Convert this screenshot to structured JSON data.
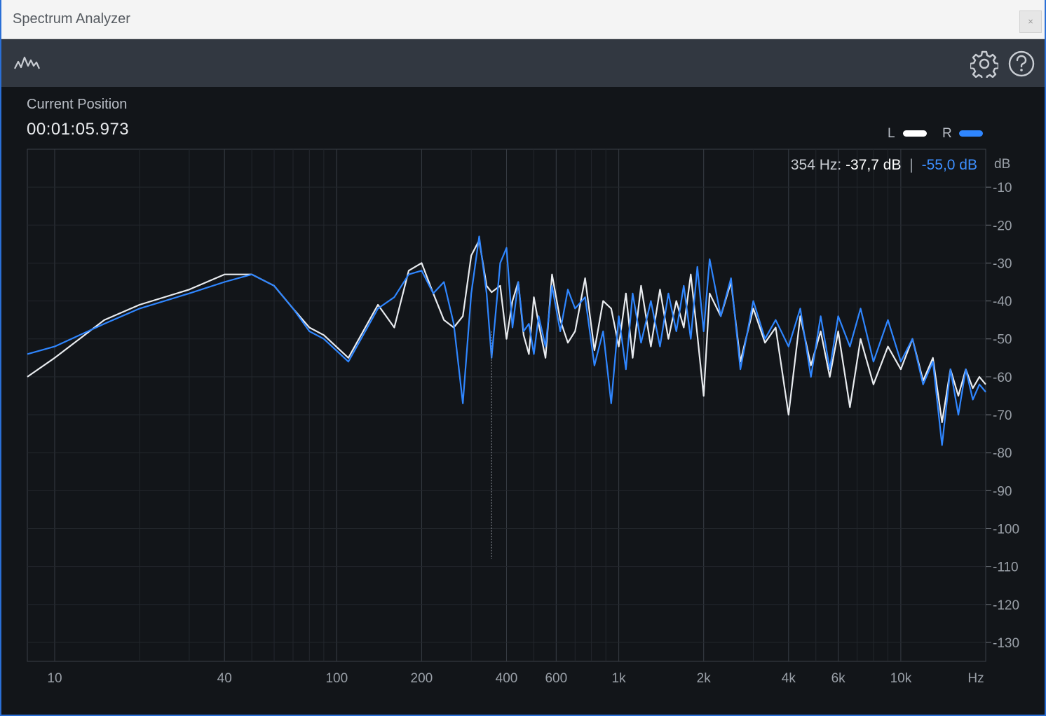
{
  "window": {
    "title": "Spectrum Analyzer",
    "close_label": "×"
  },
  "toolbar": {
    "left_icon": "spectrum-wave-icon",
    "settings_icon": "gear-icon",
    "help_icon": "help-circle-icon"
  },
  "position": {
    "label": "Current Position",
    "value": "00:01:05.973"
  },
  "legend": {
    "left": "L",
    "right": "R",
    "left_color": "#ffffff",
    "right_color": "#2f86ff"
  },
  "readout": {
    "freq": "354 Hz:",
    "left_db": "-37,7 dB",
    "separator": "|",
    "right_db": "-55,0 dB",
    "cursor_hz": 354
  },
  "chart_data": {
    "type": "line",
    "xscale": "log",
    "xlim": [
      8,
      20000
    ],
    "ylim": [
      0,
      -135
    ],
    "xlabel": "Hz",
    "ylabel": "dB",
    "x_ticks": [
      {
        "v": 10,
        "label": "10"
      },
      {
        "v": 40,
        "label": "40"
      },
      {
        "v": 100,
        "label": "100"
      },
      {
        "v": 200,
        "label": "200"
      },
      {
        "v": 400,
        "label": "400"
      },
      {
        "v": 600,
        "label": "600"
      },
      {
        "v": 1000,
        "label": "1k"
      },
      {
        "v": 2000,
        "label": "2k"
      },
      {
        "v": 4000,
        "label": "4k"
      },
      {
        "v": 6000,
        "label": "6k"
      },
      {
        "v": 10000,
        "label": "10k"
      }
    ],
    "y_ticks": [
      -10,
      -20,
      -30,
      -40,
      -50,
      -60,
      -70,
      -80,
      -90,
      -100,
      -110,
      -120,
      -130
    ],
    "series": [
      {
        "name": "L",
        "color": "#e8ebef",
        "points": [
          [
            8,
            -60
          ],
          [
            10,
            -55
          ],
          [
            15,
            -45
          ],
          [
            20,
            -41
          ],
          [
            30,
            -37
          ],
          [
            40,
            -33
          ],
          [
            50,
            -33
          ],
          [
            60,
            -36
          ],
          [
            70,
            -42
          ],
          [
            80,
            -47
          ],
          [
            90,
            -49
          ],
          [
            110,
            -55
          ],
          [
            140,
            -41
          ],
          [
            160,
            -47
          ],
          [
            180,
            -32
          ],
          [
            200,
            -30
          ],
          [
            220,
            -38
          ],
          [
            240,
            -45
          ],
          [
            260,
            -47
          ],
          [
            280,
            -44
          ],
          [
            300,
            -28
          ],
          [
            320,
            -24
          ],
          [
            340,
            -36
          ],
          [
            354,
            -37.7
          ],
          [
            380,
            -36
          ],
          [
            400,
            -50
          ],
          [
            420,
            -40
          ],
          [
            440,
            -35
          ],
          [
            460,
            -49
          ],
          [
            480,
            -54
          ],
          [
            500,
            -39
          ],
          [
            520,
            -46
          ],
          [
            550,
            -55
          ],
          [
            580,
            -33
          ],
          [
            620,
            -45
          ],
          [
            660,
            -51
          ],
          [
            700,
            -48
          ],
          [
            760,
            -34
          ],
          [
            820,
            -53
          ],
          [
            880,
            -40
          ],
          [
            940,
            -42
          ],
          [
            1000,
            -52
          ],
          [
            1060,
            -38
          ],
          [
            1120,
            -55
          ],
          [
            1200,
            -36
          ],
          [
            1300,
            -52
          ],
          [
            1400,
            -37
          ],
          [
            1500,
            -50
          ],
          [
            1600,
            -40
          ],
          [
            1700,
            -47
          ],
          [
            1800,
            -33
          ],
          [
            1900,
            -49
          ],
          [
            2000,
            -65
          ],
          [
            2100,
            -38
          ],
          [
            2300,
            -44
          ],
          [
            2500,
            -35
          ],
          [
            2700,
            -56
          ],
          [
            3000,
            -42
          ],
          [
            3300,
            -51
          ],
          [
            3600,
            -47
          ],
          [
            4000,
            -70
          ],
          [
            4400,
            -44
          ],
          [
            4800,
            -57
          ],
          [
            5200,
            -48
          ],
          [
            5600,
            -60
          ],
          [
            6000,
            -48
          ],
          [
            6600,
            -68
          ],
          [
            7200,
            -50
          ],
          [
            8000,
            -62
          ],
          [
            9000,
            -52
          ],
          [
            10000,
            -58
          ],
          [
            11000,
            -50
          ],
          [
            12000,
            -61
          ],
          [
            13000,
            -55
          ],
          [
            14000,
            -72
          ],
          [
            15000,
            -58
          ],
          [
            16000,
            -65
          ],
          [
            17000,
            -58
          ],
          [
            18000,
            -63
          ],
          [
            19000,
            -60
          ],
          [
            20000,
            -62
          ]
        ]
      },
      {
        "name": "R",
        "color": "#2f86ff",
        "points": [
          [
            8,
            -54
          ],
          [
            10,
            -52
          ],
          [
            15,
            -46
          ],
          [
            20,
            -42
          ],
          [
            30,
            -38
          ],
          [
            40,
            -35
          ],
          [
            50,
            -33
          ],
          [
            60,
            -36
          ],
          [
            70,
            -42
          ],
          [
            80,
            -48
          ],
          [
            90,
            -50
          ],
          [
            110,
            -56
          ],
          [
            140,
            -42
          ],
          [
            160,
            -39
          ],
          [
            180,
            -33
          ],
          [
            200,
            -32
          ],
          [
            220,
            -38
          ],
          [
            240,
            -35
          ],
          [
            260,
            -46
          ],
          [
            280,
            -67
          ],
          [
            300,
            -38
          ],
          [
            320,
            -23
          ],
          [
            340,
            -38
          ],
          [
            354,
            -55
          ],
          [
            380,
            -30
          ],
          [
            400,
            -26
          ],
          [
            420,
            -47
          ],
          [
            440,
            -35
          ],
          [
            460,
            -48
          ],
          [
            480,
            -46
          ],
          [
            500,
            -54
          ],
          [
            520,
            -44
          ],
          [
            550,
            -52
          ],
          [
            580,
            -36
          ],
          [
            620,
            -48
          ],
          [
            660,
            -37
          ],
          [
            700,
            -42
          ],
          [
            760,
            -39
          ],
          [
            820,
            -57
          ],
          [
            880,
            -48
          ],
          [
            940,
            -67
          ],
          [
            1000,
            -44
          ],
          [
            1060,
            -58
          ],
          [
            1120,
            -38
          ],
          [
            1200,
            -51
          ],
          [
            1300,
            -40
          ],
          [
            1400,
            -52
          ],
          [
            1500,
            -38
          ],
          [
            1600,
            -48
          ],
          [
            1700,
            -36
          ],
          [
            1800,
            -50
          ],
          [
            1900,
            -31
          ],
          [
            2000,
            -48
          ],
          [
            2100,
            -29
          ],
          [
            2300,
            -44
          ],
          [
            2500,
            -34
          ],
          [
            2700,
            -58
          ],
          [
            3000,
            -40
          ],
          [
            3300,
            -50
          ],
          [
            3600,
            -45
          ],
          [
            4000,
            -52
          ],
          [
            4400,
            -42
          ],
          [
            4800,
            -60
          ],
          [
            5200,
            -44
          ],
          [
            5600,
            -58
          ],
          [
            6000,
            -44
          ],
          [
            6600,
            -52
          ],
          [
            7200,
            -42
          ],
          [
            8000,
            -56
          ],
          [
            9000,
            -45
          ],
          [
            10000,
            -56
          ],
          [
            11000,
            -50
          ],
          [
            12000,
            -62
          ],
          [
            13000,
            -56
          ],
          [
            14000,
            -78
          ],
          [
            15000,
            -58
          ],
          [
            16000,
            -70
          ],
          [
            17000,
            -58
          ],
          [
            18000,
            -66
          ],
          [
            19000,
            -62
          ],
          [
            20000,
            -64
          ]
        ]
      }
    ]
  }
}
